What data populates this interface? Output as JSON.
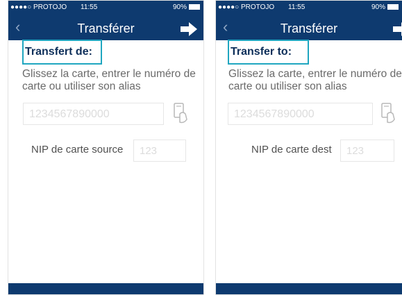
{
  "screens": [
    {
      "status": {
        "carrier": "●●●●○ PROTOJO",
        "time": "11:55",
        "battery": "90%"
      },
      "title": "Transférer",
      "section": "Transfert de:",
      "description": "Glissez la carte, entrer le numéro de carte ou utiliser son alias",
      "card_placeholder": "1234567890000",
      "pin_label": "NIP de carte source",
      "pin_placeholder": "123"
    },
    {
      "status": {
        "carrier": "●●●●○ PROTOJO",
        "time": "11:55",
        "battery": "90%"
      },
      "title": "Transférer",
      "section": "Transfer to:",
      "description": "Glissez la carte, entrer le numéro de carte ou utiliser son alias",
      "card_placeholder": "1234567890000",
      "pin_label": "NIP de carte dest",
      "pin_placeholder": "123"
    }
  ],
  "colors": {
    "header": "#0e3a6f",
    "highlight": "#1fa6c0"
  },
  "icons": [
    "back-chevron-icon",
    "forward-arrow-icon",
    "card-swipe-icon",
    "battery-icon"
  ]
}
